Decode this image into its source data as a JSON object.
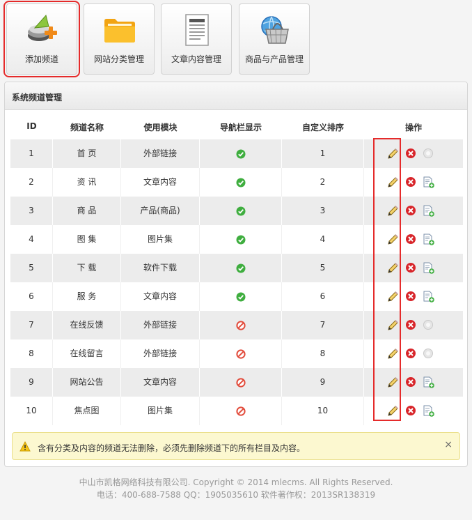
{
  "toolbar": {
    "buttons": [
      {
        "label": "添加频道",
        "icon": "add-channel-icon",
        "selected": true
      },
      {
        "label": "网站分类管理",
        "icon": "folder-icon",
        "selected": false
      },
      {
        "label": "文章内容管理",
        "icon": "document-icon",
        "selected": false
      },
      {
        "label": "商品与产品管理",
        "icon": "basket-icon",
        "selected": false
      }
    ]
  },
  "panel": {
    "title": "系统频道管理",
    "columns": [
      "ID",
      "频道名称",
      "使用模块",
      "导航栏显示",
      "自定义排序",
      "操作"
    ],
    "rows": [
      {
        "id": "1",
        "name": "首 页",
        "module": "外部链接",
        "nav": "yes",
        "order": "1",
        "extra": "disabled"
      },
      {
        "id": "2",
        "name": "资 讯",
        "module": "文章内容",
        "nav": "yes",
        "order": "2",
        "extra": "add"
      },
      {
        "id": "3",
        "name": "商 品",
        "module": "产品(商品)",
        "nav": "yes",
        "order": "3",
        "extra": "add"
      },
      {
        "id": "4",
        "name": "图 集",
        "module": "图片集",
        "nav": "yes",
        "order": "4",
        "extra": "add"
      },
      {
        "id": "5",
        "name": "下 载",
        "module": "软件下载",
        "nav": "yes",
        "order": "5",
        "extra": "add"
      },
      {
        "id": "6",
        "name": "服 务",
        "module": "文章内容",
        "nav": "yes",
        "order": "6",
        "extra": "add"
      },
      {
        "id": "7",
        "name": "在线反馈",
        "module": "外部链接",
        "nav": "no",
        "order": "7",
        "extra": "disabled"
      },
      {
        "id": "8",
        "name": "在线留言",
        "module": "外部链接",
        "nav": "no",
        "order": "8",
        "extra": "disabled"
      },
      {
        "id": "9",
        "name": "网站公告",
        "module": "文章内容",
        "nav": "no",
        "order": "9",
        "extra": "add"
      },
      {
        "id": "10",
        "name": "焦点图",
        "module": "图片集",
        "nav": "no",
        "order": "10",
        "extra": "add"
      }
    ]
  },
  "notice": {
    "text": "含有分类及内容的频道无法删除，必须先删除频道下的所有栏目及内容。",
    "close": "×"
  },
  "footer": {
    "line1": "中山市凯格网络科技有限公司. Copyright © 2014 mlecms. All Rights Reserved.",
    "line2": "电话：400-688-7588  QQ：1905035610  软件著作权：2013SR138319"
  },
  "colors": {
    "highlight": "#e52b2b",
    "check": "#3fae3f",
    "forbid": "#e24b3b",
    "delete": "#d8262b",
    "notice_bg": "#fcf8d0"
  }
}
